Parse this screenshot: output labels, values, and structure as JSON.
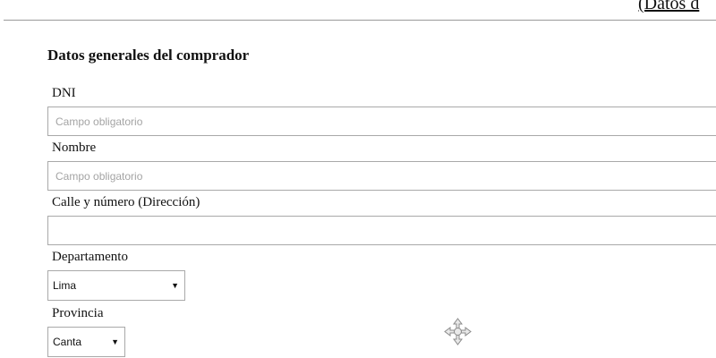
{
  "header": {
    "link_text": "(Datos d"
  },
  "form": {
    "title": "Datos generales del comprador",
    "dni": {
      "label": "DNI",
      "placeholder": "Campo obligatorio",
      "value": ""
    },
    "nombre": {
      "label": "Nombre",
      "placeholder": "Campo obligatorio",
      "value": ""
    },
    "direccion": {
      "label": "Calle y número (Dirección)",
      "placeholder": "",
      "value": ""
    },
    "departamento": {
      "label": "Departamento",
      "selected": "Lima"
    },
    "provincia": {
      "label": "Provincia",
      "selected": "Canta"
    }
  },
  "icons": {
    "dropdown": "caret-down-icon",
    "cursor": "move-cursor-icon"
  },
  "colors": {
    "border": "#a9a9a9",
    "placeholder": "#a4a4a4",
    "rule": "#9a9a9a"
  }
}
